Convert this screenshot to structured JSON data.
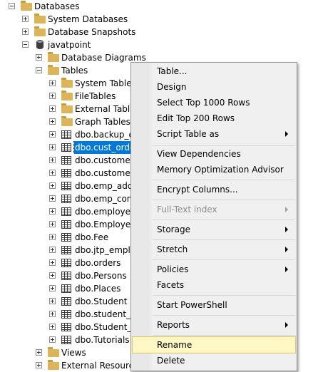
{
  "tree": {
    "databases": "Databases",
    "system_databases": "System Databases",
    "database_snapshots": "Database Snapshots",
    "javatpoint": "javatpoint",
    "database_diagrams": "Database Diagrams",
    "tables": "Tables",
    "system_tables": "System Tables",
    "file_tables": "FileTables",
    "external_tables": "External Tables",
    "graph_tables": "Graph Tables",
    "table_items": [
      "dbo.backup_er",
      "dbo.cust_order",
      "dbo.customer",
      "dbo.customer_",
      "dbo.emp_addr",
      "dbo.emp_cont",
      "dbo.employee",
      "dbo.Employee_",
      "dbo.Fee",
      "dbo.jtp_emplo",
      "dbo.orders",
      "dbo.Persons",
      "dbo.Places",
      "dbo.Student",
      "dbo.student_da",
      "dbo.Student_in",
      "dbo.Tutorials"
    ],
    "views": "Views",
    "external_resources": "External Resources"
  },
  "context_menu": {
    "items": [
      {
        "label": "Table..."
      },
      {
        "label": "Design"
      },
      {
        "label": "Select Top 1000 Rows"
      },
      {
        "label": "Edit Top 200 Rows"
      },
      {
        "label": "Script Table as"
      },
      {
        "label": "View Dependencies"
      },
      {
        "label": "Memory Optimization Advisor"
      },
      {
        "label": "Encrypt Columns..."
      },
      {
        "label": "Full-Text index"
      },
      {
        "label": "Storage"
      },
      {
        "label": "Stretch"
      },
      {
        "label": "Policies"
      },
      {
        "label": "Facets"
      },
      {
        "label": "Start PowerShell"
      },
      {
        "label": "Reports"
      },
      {
        "label": "Rename"
      },
      {
        "label": "Delete"
      }
    ]
  },
  "colors": {
    "selection": "#0078d7",
    "menu_highlight": "#fff8c5",
    "folder": "#dcb459"
  }
}
